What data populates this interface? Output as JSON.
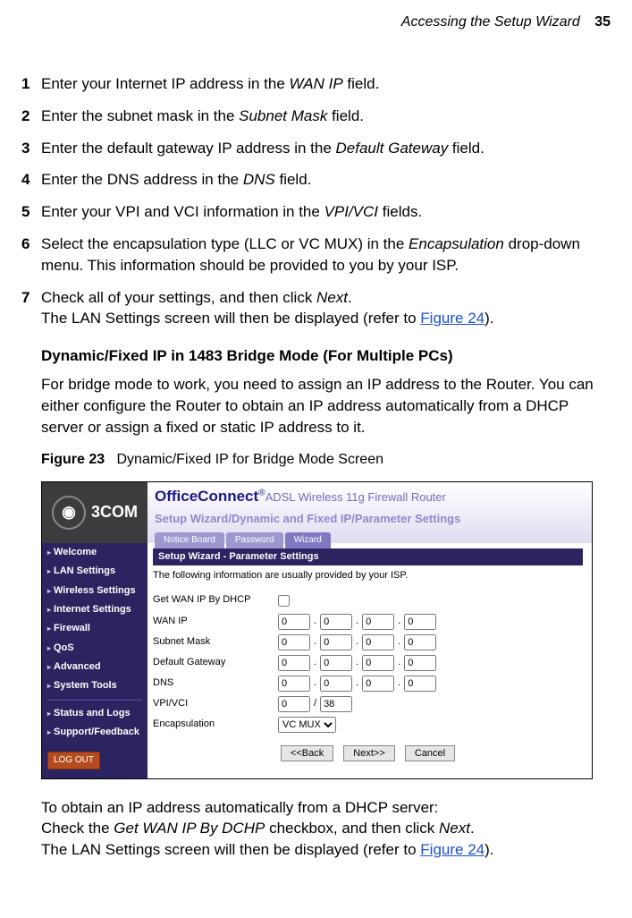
{
  "header": {
    "section": "Accessing the Setup Wizard",
    "page": "35"
  },
  "steps": [
    {
      "n": "1",
      "pre": "Enter your Internet IP address in the ",
      "it": "WAN IP",
      "post": " field."
    },
    {
      "n": "2",
      "pre": "Enter the subnet mask in the ",
      "it": "Subnet Mask",
      "post": " field."
    },
    {
      "n": "3",
      "pre": "Enter the default gateway IP address in the ",
      "it": "Default Gateway",
      "post": " field."
    },
    {
      "n": "4",
      "pre": "Enter the DNS address in the ",
      "it": "DNS",
      "post": " field."
    },
    {
      "n": "5",
      "pre": "Enter your VPI and VCI information in the ",
      "it": "VPI/VCI",
      "post": " fields."
    },
    {
      "n": "6",
      "pre": "Select the encapsulation type (LLC or VC MUX) in the ",
      "it": "Encapsulation",
      "post": " drop-down menu. This information should be provided to you by your ISP."
    },
    {
      "n": "7",
      "pre": "Check all of your settings, and then click ",
      "it": "Next",
      "post": ".",
      "extra_plain": "The LAN Settings screen will then be displayed (refer to ",
      "extra_link": "Figure 24",
      "extra_close": ")."
    }
  ],
  "subhead": "Dynamic/Fixed IP in 1483 Bridge Mode (For Multiple PCs)",
  "para1": "For bridge mode to work, you need to assign an IP address to the Router. You can either configure the Router to obtain an IP address automatically from a DHCP server or assign a fixed or static IP address to it.",
  "fig": {
    "label": "Figure 23",
    "caption": "Dynamic/Fixed IP for Bridge Mode Screen"
  },
  "closing": {
    "l1": "To obtain an IP address automatically from a DHCP server:",
    "l2a": "Check the ",
    "l2it": "Get WAN IP By DCHP",
    "l2b": " checkbox, and then click ",
    "l2it2": "Next",
    "l2c": ".",
    "l3a": "The LAN Settings screen will then be displayed (refer to ",
    "l3link": "Figure 24",
    "l3b": ")."
  },
  "ui": {
    "logo": "3COM",
    "brand_strong": "OfficeConnect",
    "brand_reg": "®",
    "brand_model": "ADSL Wireless 11g Firewall Router",
    "crumb": "Setup Wizard/Dynamic and Fixed IP/Parameter Settings",
    "tabs": [
      "Notice Board",
      "Password",
      "Wizard"
    ],
    "active_tab": 2,
    "side": [
      "Welcome",
      "LAN Settings",
      "Wireless Settings",
      "Internet Settings",
      "Firewall",
      "QoS",
      "Advanced",
      "System Tools"
    ],
    "side2": [
      "Status and Logs",
      "Support/Feedback"
    ],
    "logout": "LOG OUT",
    "panel_hdr": "Setup Wizard - Parameter Settings",
    "panel_note": "The following information are usually provided by your ISP.",
    "rows": {
      "dhcp": "Get WAN IP By DHCP",
      "wanip": "WAN IP",
      "subnet": "Subnet Mask",
      "gw": "Default Gateway",
      "dns": "DNS",
      "vpivci": "VPI/VCI",
      "encaps": "Encapsulation"
    },
    "ip": {
      "wan": [
        "0",
        "0",
        "0",
        "0"
      ],
      "subnet": [
        "0",
        "0",
        "0",
        "0"
      ],
      "gw": [
        "0",
        "0",
        "0",
        "0"
      ],
      "dns": [
        "0",
        "0",
        "0",
        "0"
      ]
    },
    "vpi": "0",
    "vci": "38",
    "encaps_sel": "VC MUX",
    "buttons": {
      "back": "<<Back",
      "next": "Next>>",
      "cancel": "Cancel"
    }
  }
}
